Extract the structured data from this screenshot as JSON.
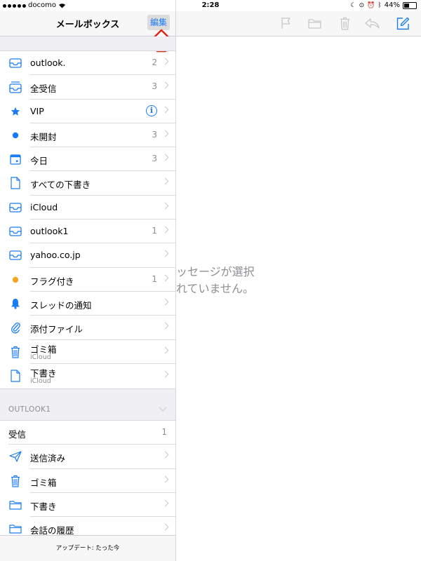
{
  "status_bar": {
    "carrier": "docomo",
    "time": "2:28",
    "battery": "44%"
  },
  "sidebar": {
    "title": "メールボックス",
    "edit_label": "編集",
    "mailboxes": [
      {
        "label": "outlook.",
        "count": "2",
        "icon": "inbox-icon"
      },
      {
        "label": "全受信",
        "count": "3",
        "icon": "all-inboxes-icon"
      },
      {
        "label": "VIP",
        "count": "",
        "icon": "star-icon"
      },
      {
        "label": "未開封",
        "count": "3",
        "icon": "unread-dot-icon"
      },
      {
        "label": "今日",
        "count": "3",
        "icon": "calendar-icon"
      },
      {
        "label": "すべての下書き",
        "count": "",
        "icon": "document-icon"
      },
      {
        "label": "iCloud",
        "count": "",
        "icon": "inbox-icon"
      },
      {
        "label": "outlook1",
        "count": "1",
        "icon": "inbox-icon"
      },
      {
        "label": "yahoo.co.jp",
        "count": "",
        "icon": "inbox-icon"
      },
      {
        "label": "フラグ付き",
        "count": "1",
        "icon": "flag-dot-icon"
      },
      {
        "label": "スレッドの通知",
        "count": "",
        "icon": "bell-icon"
      },
      {
        "label": "添付ファイル",
        "count": "",
        "icon": "paperclip-icon"
      },
      {
        "label": "ゴミ箱",
        "sub": "iCloud",
        "count": "",
        "icon": "trash-icon"
      },
      {
        "label": "下書き",
        "sub": "iCloud",
        "count": "",
        "icon": "document-icon"
      }
    ],
    "vip_info": "i",
    "section_title": "OUTLOOK1",
    "account_items": [
      {
        "label": "受信",
        "count": "1"
      },
      {
        "label": "送信済み",
        "icon": "paper-plane-icon"
      },
      {
        "label": "ゴミ箱",
        "icon": "trash-icon"
      },
      {
        "label": "下書き",
        "icon": "folder-icon"
      },
      {
        "label": "会話の履歴",
        "icon": "folder-icon"
      }
    ],
    "footer": "アップデート: たった今"
  },
  "detail": {
    "empty_line1": "ッセージが選択",
    "empty_line2": "れていません。"
  },
  "colors": {
    "accent": "#1a7cf2",
    "flag": "#f5a623",
    "arrow": "#e0231a"
  }
}
